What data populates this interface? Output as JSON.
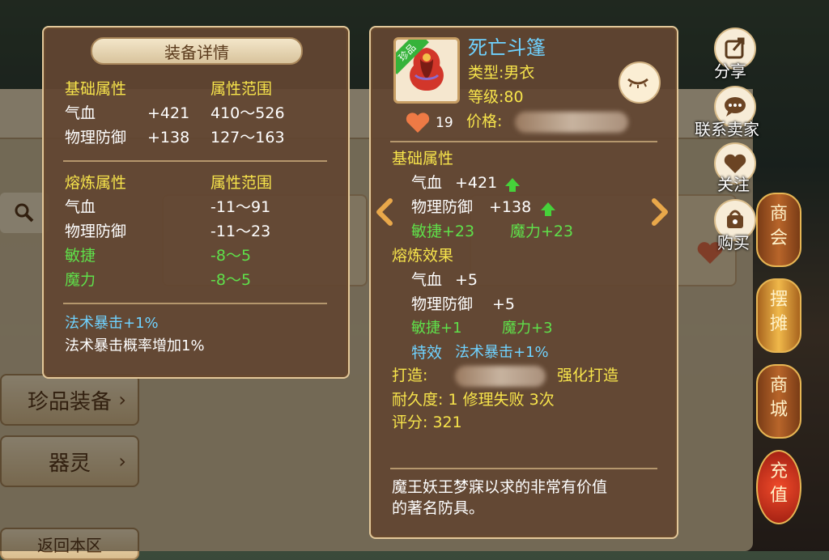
{
  "background": {
    "left_buttons": [
      {
        "label": "珍品装备",
        "top": 0
      },
      {
        "label": "器灵",
        "top": 0
      }
    ],
    "return_label": "返回本区"
  },
  "left_panel": {
    "title": "装备详情",
    "base_header": "基础属性",
    "range_header": "属性范围",
    "base_rows": [
      {
        "name": "气血",
        "value": "+421",
        "range": "410～526"
      },
      {
        "name": "物理防御",
        "value": "+138",
        "range": "127～163"
      }
    ],
    "refine_header": "熔炼属性",
    "refine_range_header": "属性范围",
    "refine_rows": [
      {
        "name": "气血",
        "range": "-11～91"
      },
      {
        "name": "物理防御",
        "range": "-11～23"
      },
      {
        "name": "敏捷",
        "range": "-8～5"
      },
      {
        "name": "魔力",
        "range": "-8～5"
      }
    ],
    "skill_name": "法术暴击+1%",
    "skill_desc": "法术暴击概率增加1%"
  },
  "right_panel": {
    "badge": "珍品",
    "item_name": "死亡斗篷",
    "type_line": "类型:男衣",
    "level_line": "等级:80",
    "likes": "19",
    "price_label": "价格:",
    "base_header": "基础属性",
    "base_rows": [
      {
        "name": "气血",
        "value": "+421"
      },
      {
        "name": "物理防御",
        "value": "+138"
      }
    ],
    "green_stats": [
      "敏捷+23",
      "魔力+23"
    ],
    "refine_header": "熔炼效果",
    "refine_rows": [
      {
        "name": "气血",
        "value": "+5"
      },
      {
        "name": "物理防御",
        "value": "+5"
      }
    ],
    "refine_green": [
      "敏捷+1",
      "魔力+3"
    ],
    "special_label": "特效",
    "special_value": "法术暴击+1%",
    "forge_label": "打造:",
    "forge_suffix": "强化打造",
    "durability_line": "耐久度: 1 修理失败 3次",
    "score_line": "评分: 321",
    "description": [
      "魔王妖王梦寐以求的非常有价值",
      "的著名防具。"
    ]
  },
  "side_actions": {
    "share": "分享",
    "contact": "联系卖家",
    "follow": "关注",
    "buy": "购买"
  },
  "lanterns": [
    {
      "label": "商会"
    },
    {
      "label": "摆摊"
    },
    {
      "label": "商城"
    },
    {
      "label": "充值"
    }
  ],
  "colors": {
    "yellow_text": "#f7e44b",
    "green_text": "#5fe04a",
    "blue_text": "#6fd2ff",
    "panel_bg": "#624632",
    "panel_border": "#e3c89a"
  },
  "icons": {
    "like": "heart-icon",
    "eye": "closed-eye-icon",
    "share": "share-icon",
    "contact": "chat-bubble-icon",
    "follow": "heart-icon",
    "buy": "bag-icon",
    "prev": "chevron-left-icon",
    "next": "chevron-right-icon",
    "upgrade": "arrow-up-icon"
  }
}
